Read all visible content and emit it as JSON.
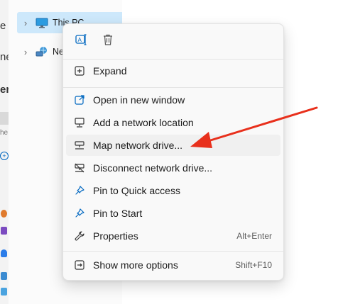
{
  "nav": {
    "this_pc_label": "This PC",
    "network_label": "Netw",
    "left_fragments": [
      "e",
      "ne",
      "er",
      "he"
    ]
  },
  "context_menu": {
    "quick_actions": [
      {
        "name": "rename",
        "icon": "rename-icon"
      },
      {
        "name": "delete",
        "icon": "trash-icon"
      }
    ],
    "items": [
      {
        "label": "Expand",
        "icon": "expand-icon",
        "shortcut": ""
      },
      {
        "label": "Open in new window",
        "icon": "open-new-window-icon",
        "shortcut": ""
      },
      {
        "label": "Add a network location",
        "icon": "network-location-icon",
        "shortcut": ""
      },
      {
        "label": "Map network drive...",
        "icon": "map-drive-icon",
        "shortcut": ""
      },
      {
        "label": "Disconnect network drive...",
        "icon": "disconnect-drive-icon",
        "shortcut": ""
      },
      {
        "label": "Pin to Quick access",
        "icon": "pin-icon",
        "shortcut": ""
      },
      {
        "label": "Pin to Start",
        "icon": "pin-icon",
        "shortcut": ""
      },
      {
        "label": "Properties",
        "icon": "wrench-icon",
        "shortcut": "Alt+Enter"
      },
      {
        "label": "Show more options",
        "icon": "show-more-icon",
        "shortcut": "Shift+F10"
      }
    ]
  },
  "colors": {
    "accent": "#0067c0",
    "selection": "#cde8fb",
    "arrow": "#e8301c"
  }
}
